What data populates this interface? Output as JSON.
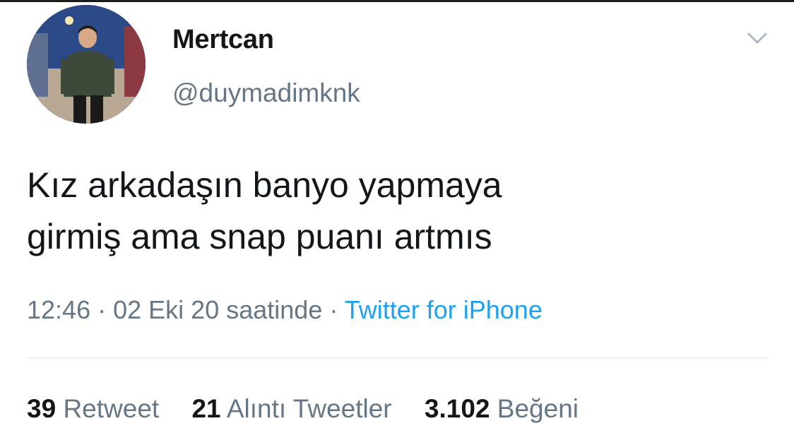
{
  "tweet": {
    "display_name": "Mertcan",
    "handle": "@duymadimknk",
    "text_line1": "Kız arkadaşın banyo yapmaya",
    "text_line2": "girmiş ama snap puanı artmıs",
    "time": "12:46",
    "separator": "·",
    "date": "02 Eki 20 saatinde",
    "source": "Twitter for iPhone"
  },
  "stats": {
    "retweets_count": "39",
    "retweets_label": "Retweet",
    "quotes_count": "21",
    "quotes_label": "Alıntı Tweetler",
    "likes_count": "3.102",
    "likes_label": "Beğeni"
  },
  "icons": {
    "menu": "chevron-down-icon"
  },
  "colors": {
    "text": "#14171a",
    "secondary": "#657786",
    "link": "#1da1f2",
    "divider": "#e1e8ed"
  }
}
